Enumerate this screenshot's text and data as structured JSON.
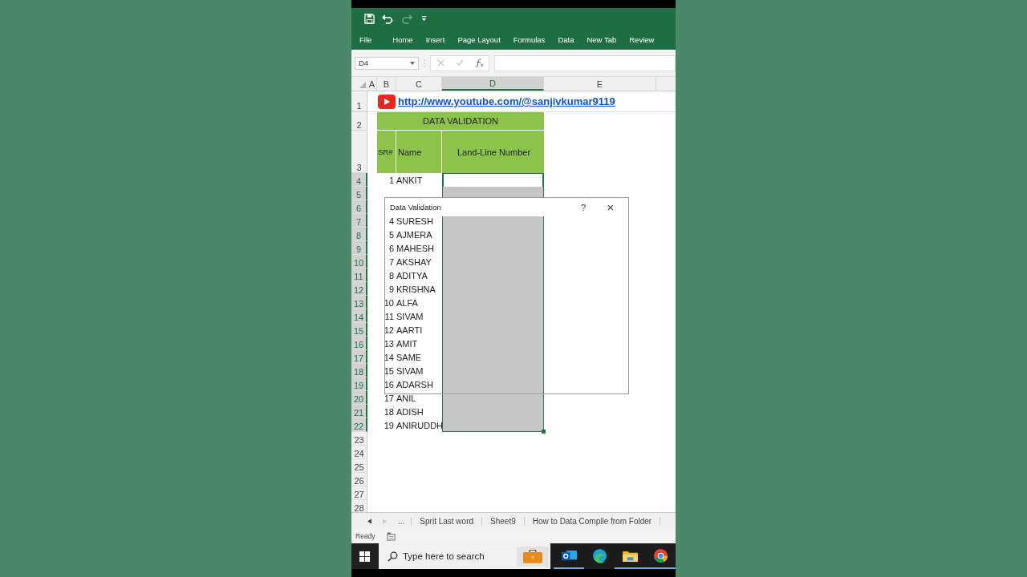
{
  "ribbon_tabs": [
    {
      "label": "File"
    },
    {
      "label": "Home"
    },
    {
      "label": "Insert"
    },
    {
      "label": "Page Layout"
    },
    {
      "label": "Formulas"
    },
    {
      "label": "Data"
    },
    {
      "label": "New Tab"
    },
    {
      "label": "Review"
    }
  ],
  "name_box": "D4",
  "columns": [
    {
      "label": "A",
      "selected": false
    },
    {
      "label": "B",
      "selected": false
    },
    {
      "label": "C",
      "selected": false
    },
    {
      "label": "D",
      "selected": true
    },
    {
      "label": "E",
      "selected": false
    }
  ],
  "link_row": {
    "number": "1",
    "text": "http://www.youtube.com/@sanjivkumar9119"
  },
  "title_row": {
    "number": "2",
    "text": "DATA VALIDATION"
  },
  "header_row": {
    "number": "3",
    "cells": [
      "SR#",
      "Name",
      "Land-Line Number"
    ]
  },
  "rows": [
    {
      "number": "4",
      "sr": "1",
      "name": "ANKIT",
      "selected": true,
      "active": true
    },
    {
      "number": "5",
      "selected": true,
      "active": false
    },
    {
      "number": "6",
      "selected": true,
      "active": false
    },
    {
      "number": "7",
      "sr": "4",
      "name": "SURESH",
      "selected": true,
      "active": false
    },
    {
      "number": "8",
      "sr": "5",
      "name": "AJMERA",
      "selected": true,
      "active": false
    },
    {
      "number": "9",
      "sr": "6",
      "name": "MAHESH",
      "selected": true,
      "active": false
    },
    {
      "number": "10",
      "sr": "7",
      "name": "AKSHAY",
      "selected": true,
      "active": false
    },
    {
      "number": "11",
      "sr": "8",
      "name": "ADITYA",
      "selected": true,
      "active": false
    },
    {
      "number": "12",
      "sr": "9",
      "name": "KRISHNA",
      "selected": true,
      "active": false
    },
    {
      "number": "13",
      "sr": "10",
      "name": "ALFA",
      "selected": true,
      "active": false
    },
    {
      "number": "14",
      "sr": "11",
      "name": "SIVAM",
      "selected": true,
      "active": false
    },
    {
      "number": "15",
      "sr": "12",
      "name": "AARTI",
      "selected": true,
      "active": false
    },
    {
      "number": "16",
      "sr": "13",
      "name": "AMIT",
      "selected": true,
      "active": false
    },
    {
      "number": "17",
      "sr": "14",
      "name": "SAME",
      "selected": true,
      "active": false
    },
    {
      "number": "18",
      "sr": "15",
      "name": "SIVAM",
      "selected": true,
      "active": false
    },
    {
      "number": "19",
      "sr": "16",
      "name": "ADARSH",
      "selected": true,
      "active": false
    },
    {
      "number": "20",
      "sr": "17",
      "name": "ANIL",
      "selected": true,
      "active": false
    },
    {
      "number": "21",
      "sr": "18",
      "name": "ADISH",
      "selected": true,
      "active": false
    },
    {
      "number": "22",
      "sr": "19",
      "name": "ANIRUDDH",
      "selected": true,
      "active": false
    },
    {
      "number": "23",
      "selected": false
    },
    {
      "number": "24",
      "selected": false
    },
    {
      "number": "25",
      "selected": false
    },
    {
      "number": "26",
      "selected": false
    },
    {
      "number": "27",
      "selected": false
    },
    {
      "number": "28",
      "selected": false
    }
  ],
  "dialog": {
    "title": "Data Validation",
    "help": "?",
    "close": "×"
  },
  "sheet_tabs": {
    "more": "...",
    "tabs": [
      {
        "label": "Sprit Last word"
      },
      {
        "label": "Sheet9"
      },
      {
        "label": "How to Data Compile from Folder"
      }
    ]
  },
  "status": "Ready",
  "taskbar": {
    "search_placeholder": "Type here to search",
    "apps": [
      {
        "kind": "mail",
        "running": true
      },
      {
        "kind": "browser",
        "running": false
      },
      {
        "kind": "folder",
        "running": true
      },
      {
        "kind": "chrome",
        "running": true
      }
    ]
  }
}
